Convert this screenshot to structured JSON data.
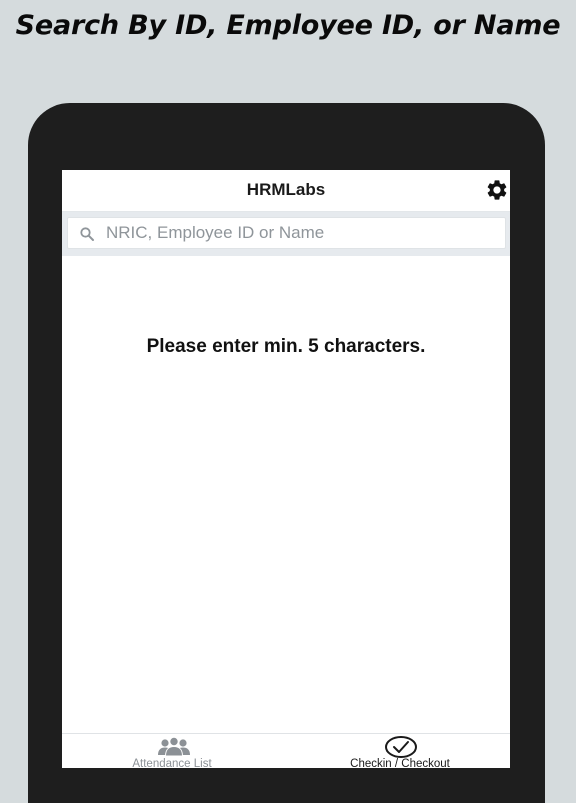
{
  "promo": {
    "title": "Search By ID, Employee ID, or Name"
  },
  "header": {
    "title": "HRMLabs",
    "settings_icon": "gear-icon"
  },
  "search": {
    "placeholder": "NRIC, Employee ID or Name",
    "value": "",
    "icon": "search-icon"
  },
  "main": {
    "message": "Please enter min. 5 characters."
  },
  "bottom_nav": {
    "tabs": [
      {
        "label": "Attendance List",
        "icon": "users-icon",
        "active": false
      },
      {
        "label": "Checkin / Checkout",
        "icon": "check-circle-icon",
        "active": true
      }
    ]
  },
  "colors": {
    "background": "#d5dbdd",
    "frame": "#1e1e1e",
    "inactive": "#8c9196",
    "active": "#1a1a1a"
  }
}
